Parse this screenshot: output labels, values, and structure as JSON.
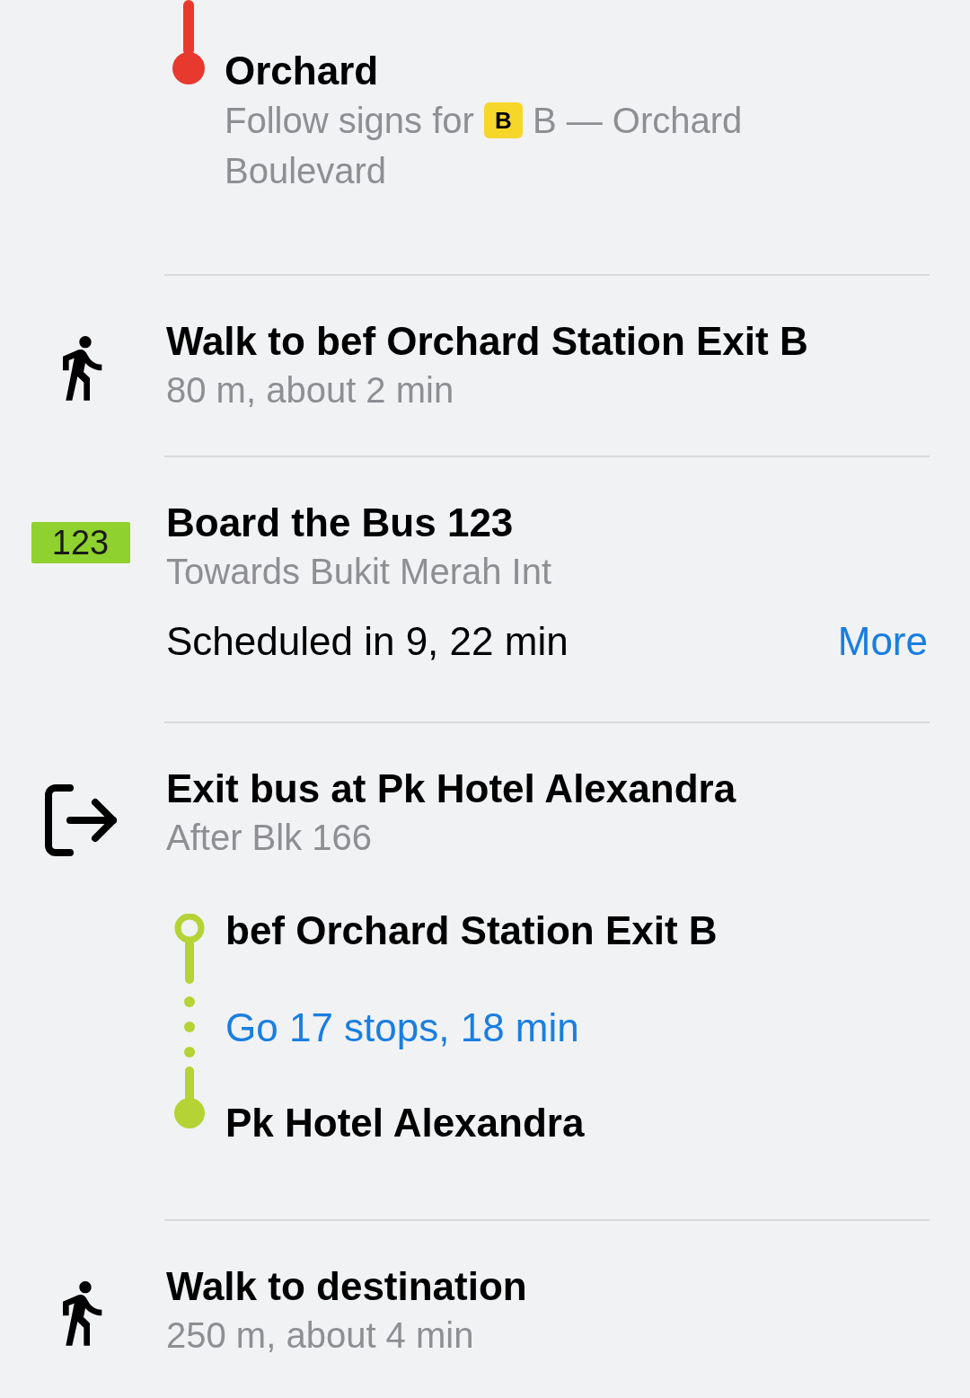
{
  "origin_stop": {
    "name": "Orchard",
    "subtitle_before": "Follow signs for",
    "exit_badge": "B",
    "subtitle_after": "B — Orchard Boulevard"
  },
  "steps": [
    {
      "kind": "walk",
      "title": "Walk to bef Orchard Station Exit B",
      "subtitle": "80 m, about 2 min"
    },
    {
      "kind": "bus",
      "badge": "123",
      "title": "Board the Bus 123",
      "subtitle": "Towards Bukit Merah Int",
      "schedule": "Scheduled in 9, 22 min",
      "more_link": "More"
    },
    {
      "kind": "exit",
      "title": "Exit bus at Pk Hotel Alexandra",
      "subtitle": "After Blk 166",
      "stops": {
        "from": "bef Orchard Station Exit B",
        "ride": "Go 17 stops, 18 min",
        "to": "Pk Hotel Alexandra"
      }
    },
    {
      "kind": "walk",
      "title": "Walk to destination",
      "subtitle": "250 m, about 4 min"
    }
  ]
}
